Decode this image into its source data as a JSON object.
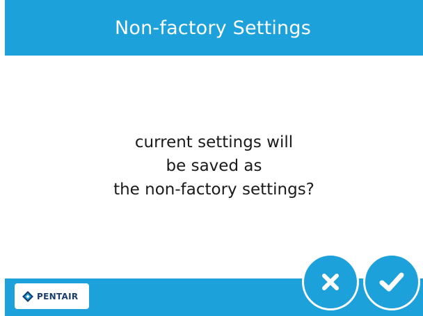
{
  "header": {
    "title": "Non-factory Settings"
  },
  "dialog": {
    "message_lines": [
      "current settings will",
      "be saved as",
      "the non-factory settings?"
    ]
  },
  "footer": {
    "logo_text": "PENTAIR"
  },
  "buttons": {
    "cancel_icon": "close-x-icon",
    "confirm_icon": "checkmark-icon"
  },
  "colors": {
    "accent": "#1da1db",
    "background": "#ffffff",
    "text": "#1a1a1a",
    "logo_navy": "#1a3d6e"
  }
}
